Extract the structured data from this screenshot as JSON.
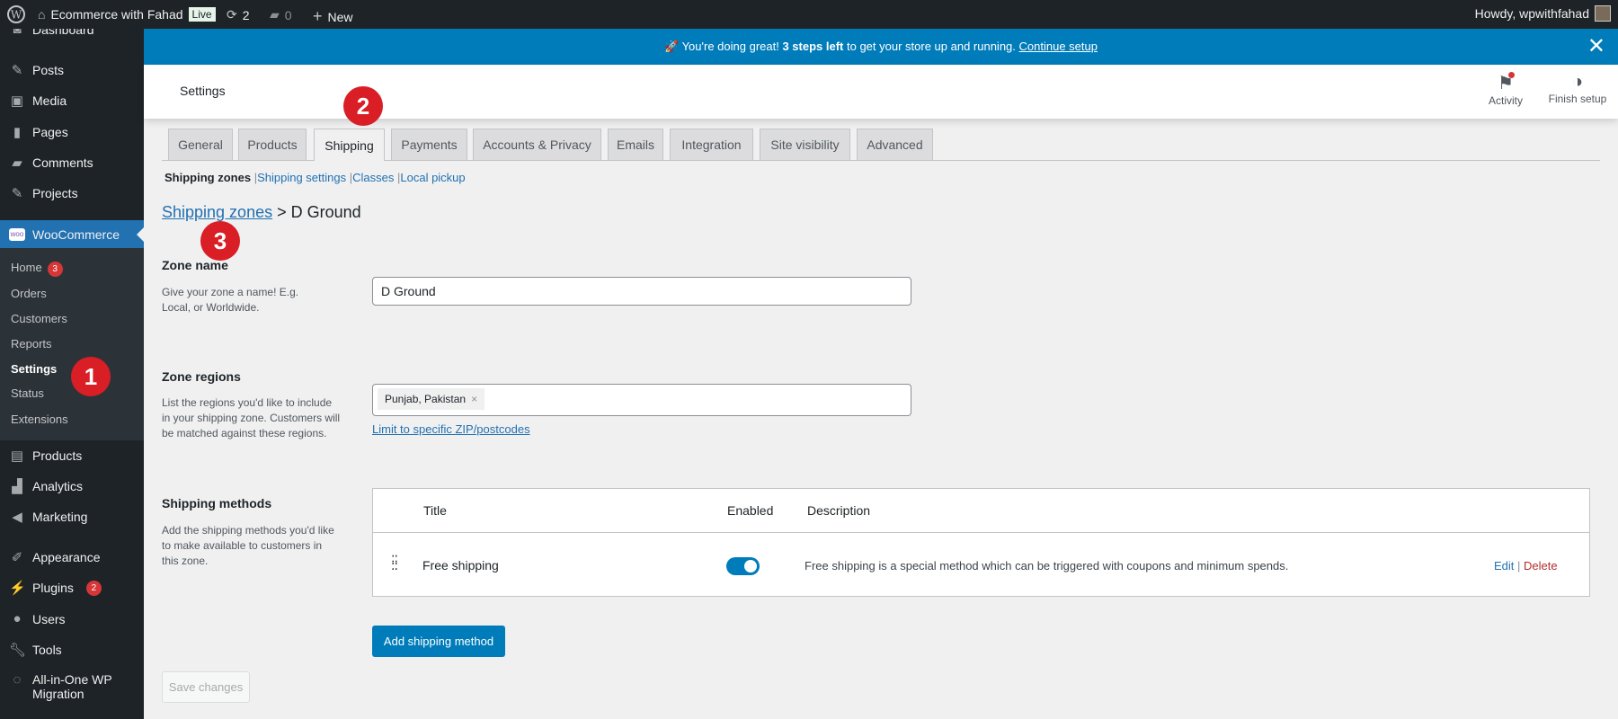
{
  "adminbar": {
    "site": "Ecommerce with Fahad",
    "live": "Live",
    "updates": "2",
    "comments": "0",
    "new": "New",
    "howdy": "Howdy, wpwithfahad"
  },
  "sidebar": {
    "top": [
      {
        "label": "Dashboard",
        "icon": "dashboard-icon"
      },
      {
        "label": "Posts",
        "icon": "pin-icon"
      },
      {
        "label": "Media",
        "icon": "media-icon"
      },
      {
        "label": "Pages",
        "icon": "pages-icon"
      },
      {
        "label": "Comments",
        "icon": "comment-icon"
      },
      {
        "label": "Projects",
        "icon": "pin-icon"
      }
    ],
    "woocommerce": "WooCommerce",
    "sub": [
      {
        "label": "Home",
        "badge": "3"
      },
      {
        "label": "Orders"
      },
      {
        "label": "Customers"
      },
      {
        "label": "Reports"
      },
      {
        "label": "Settings"
      },
      {
        "label": "Status"
      },
      {
        "label": "Extensions"
      }
    ],
    "bottom": [
      {
        "label": "Products"
      },
      {
        "label": "Analytics"
      },
      {
        "label": "Marketing"
      },
      {
        "label": "Appearance"
      },
      {
        "label": "Plugins",
        "badge": "2"
      },
      {
        "label": "Users"
      },
      {
        "label": "Tools"
      },
      {
        "label": "All-in-One WP",
        "label2": "Migration"
      }
    ]
  },
  "banner": {
    "prefix": "🚀 You're doing great! ",
    "bold": "3 steps left",
    "suffix": " to get your store up and running. ",
    "link": "Continue setup"
  },
  "header": {
    "title": "Settings",
    "activity": "Activity",
    "finish": "Finish setup"
  },
  "tabs": [
    "General",
    "Products",
    "Shipping",
    "Payments",
    "Accounts & Privacy",
    "Emails",
    "Integration",
    "Site visibility",
    "Advanced"
  ],
  "subnav": {
    "current": "Shipping zones",
    "links": [
      "Shipping settings",
      "Classes",
      "Local pickup"
    ]
  },
  "breadcrumb": {
    "link": "Shipping zones",
    "sep": " > ",
    "current": "D Ground"
  },
  "zone_name": {
    "label": "Zone name",
    "desc": "Give your zone a name! E.g. Local, or Worldwide.",
    "value": "D Ground"
  },
  "zone_regions": {
    "label": "Zone regions",
    "desc": "List the regions you'd like to include in your shipping zone. Customers will be matched against these regions.",
    "chip": "Punjab, Pakistan",
    "limit_link": "Limit to specific ZIP/postcodes"
  },
  "methods": {
    "label": "Shipping methods",
    "desc": "Add the shipping methods you'd like to make available to customers in this zone.",
    "columns": [
      "Title",
      "Enabled",
      "Description"
    ],
    "rows": [
      {
        "title": "Free shipping",
        "enabled": true,
        "description": "Free shipping is a special method which can be triggered with coupons and minimum spends.",
        "edit": "Edit",
        "delete": "Delete"
      }
    ],
    "add_button": "Add shipping method"
  },
  "save_button": "Save changes",
  "annotations": [
    "1",
    "2",
    "3"
  ],
  "colors": {
    "accent": "#007cba",
    "annotation": "#d91e25"
  }
}
